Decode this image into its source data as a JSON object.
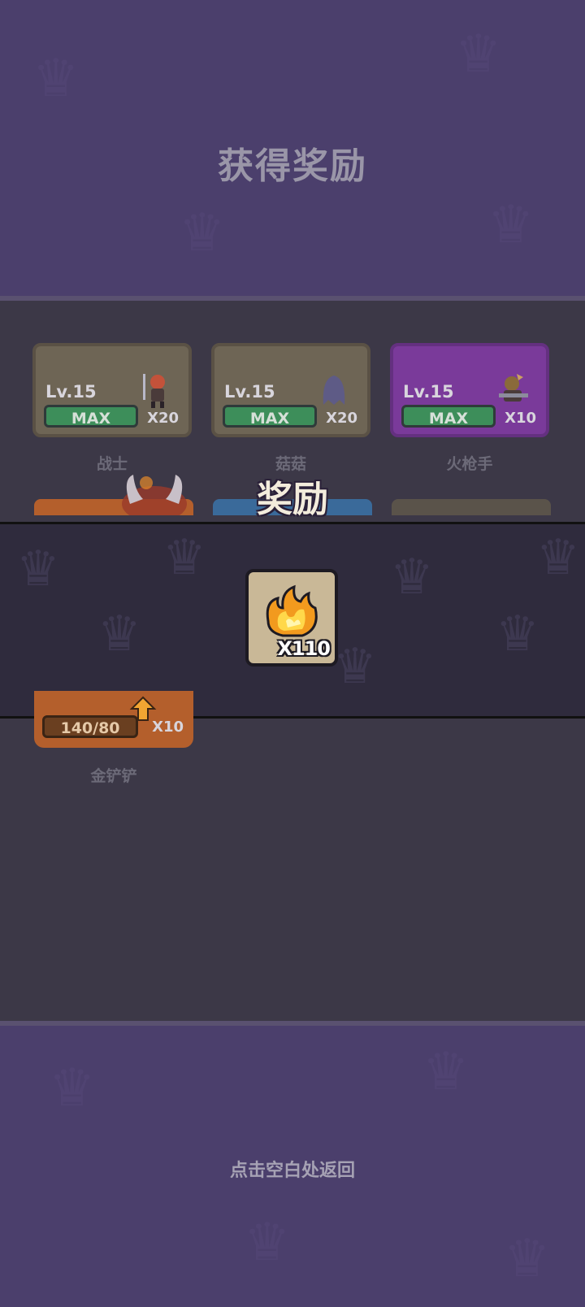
{
  "header": {
    "title": "获得奖励"
  },
  "heroes": [
    {
      "level": "Lv.15",
      "status": "MAX",
      "count": "X20",
      "name": "战士",
      "color": "#6e6555"
    },
    {
      "level": "Lv.15",
      "status": "MAX",
      "count": "X20",
      "name": "菇菇",
      "color": "#6e6555"
    },
    {
      "level": "Lv.15",
      "status": "MAX",
      "count": "X10",
      "name": "火枪手",
      "color": "#7a3a9a"
    }
  ],
  "reward_popup": {
    "title": "奖励",
    "item": {
      "icon": "fire-icon",
      "quantity": "X110"
    }
  },
  "gold_shovel": {
    "progress": "140/80",
    "count": "X10",
    "name": "金铲铲"
  },
  "footer": {
    "hint": "点击空白处返回"
  }
}
